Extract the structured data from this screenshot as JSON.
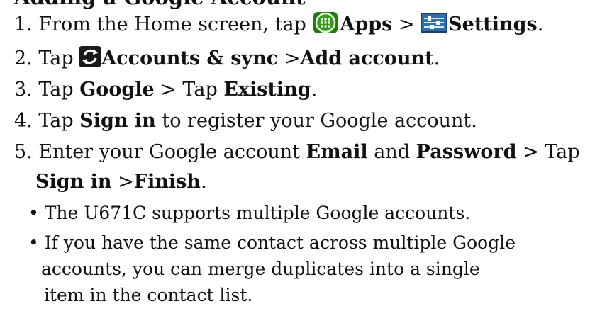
{
  "heading_partial": "Adding a Google Account",
  "steps": [
    {
      "num": "1.",
      "pre": "From the Home screen, tap ",
      "icon1": "apps-grid-icon",
      "b1": "Apps",
      "sep": " > ",
      "icon2": "settings-sliders-icon",
      "b2": "Settings",
      "post": "."
    },
    {
      "num": "2.",
      "pre": "Tap ",
      "icon1": "sync-icon",
      "b1": "Accounts & sync",
      "sep": " >",
      "b2": "Add account",
      "post": "."
    },
    {
      "num": "3.",
      "pre": "Tap ",
      "b1": "Google",
      "sep": " > Tap ",
      "b2": "Existing",
      "post": "."
    },
    {
      "num": "4.",
      "pre": "Tap ",
      "b1": "Sign in",
      "post": " to register your Google account."
    },
    {
      "num": "5.",
      "pre": "Enter your Google account ",
      "b1": "Email",
      "mid": " and ",
      "b2": "Password",
      "post": " > Tap",
      "cont_b1": "Sign in",
      "cont_sep": " >",
      "cont_b2": "Finish",
      "cont_post": "."
    }
  ],
  "bullets": [
    {
      "mark": "•",
      "text": "The U671C supports multiple Google accounts."
    },
    {
      "mark": "•",
      "line1": "If you have the same contact across multiple Google",
      "line2": "accounts, you can merge duplicates into a single",
      "line3": "item in the contact list."
    }
  ],
  "colors": {
    "text": "#111111",
    "apps_icon_green": "#3a9a1c",
    "sync_icon_dark": "#2b2b2b",
    "settings_icon_blue": "#2f6fb0"
  }
}
